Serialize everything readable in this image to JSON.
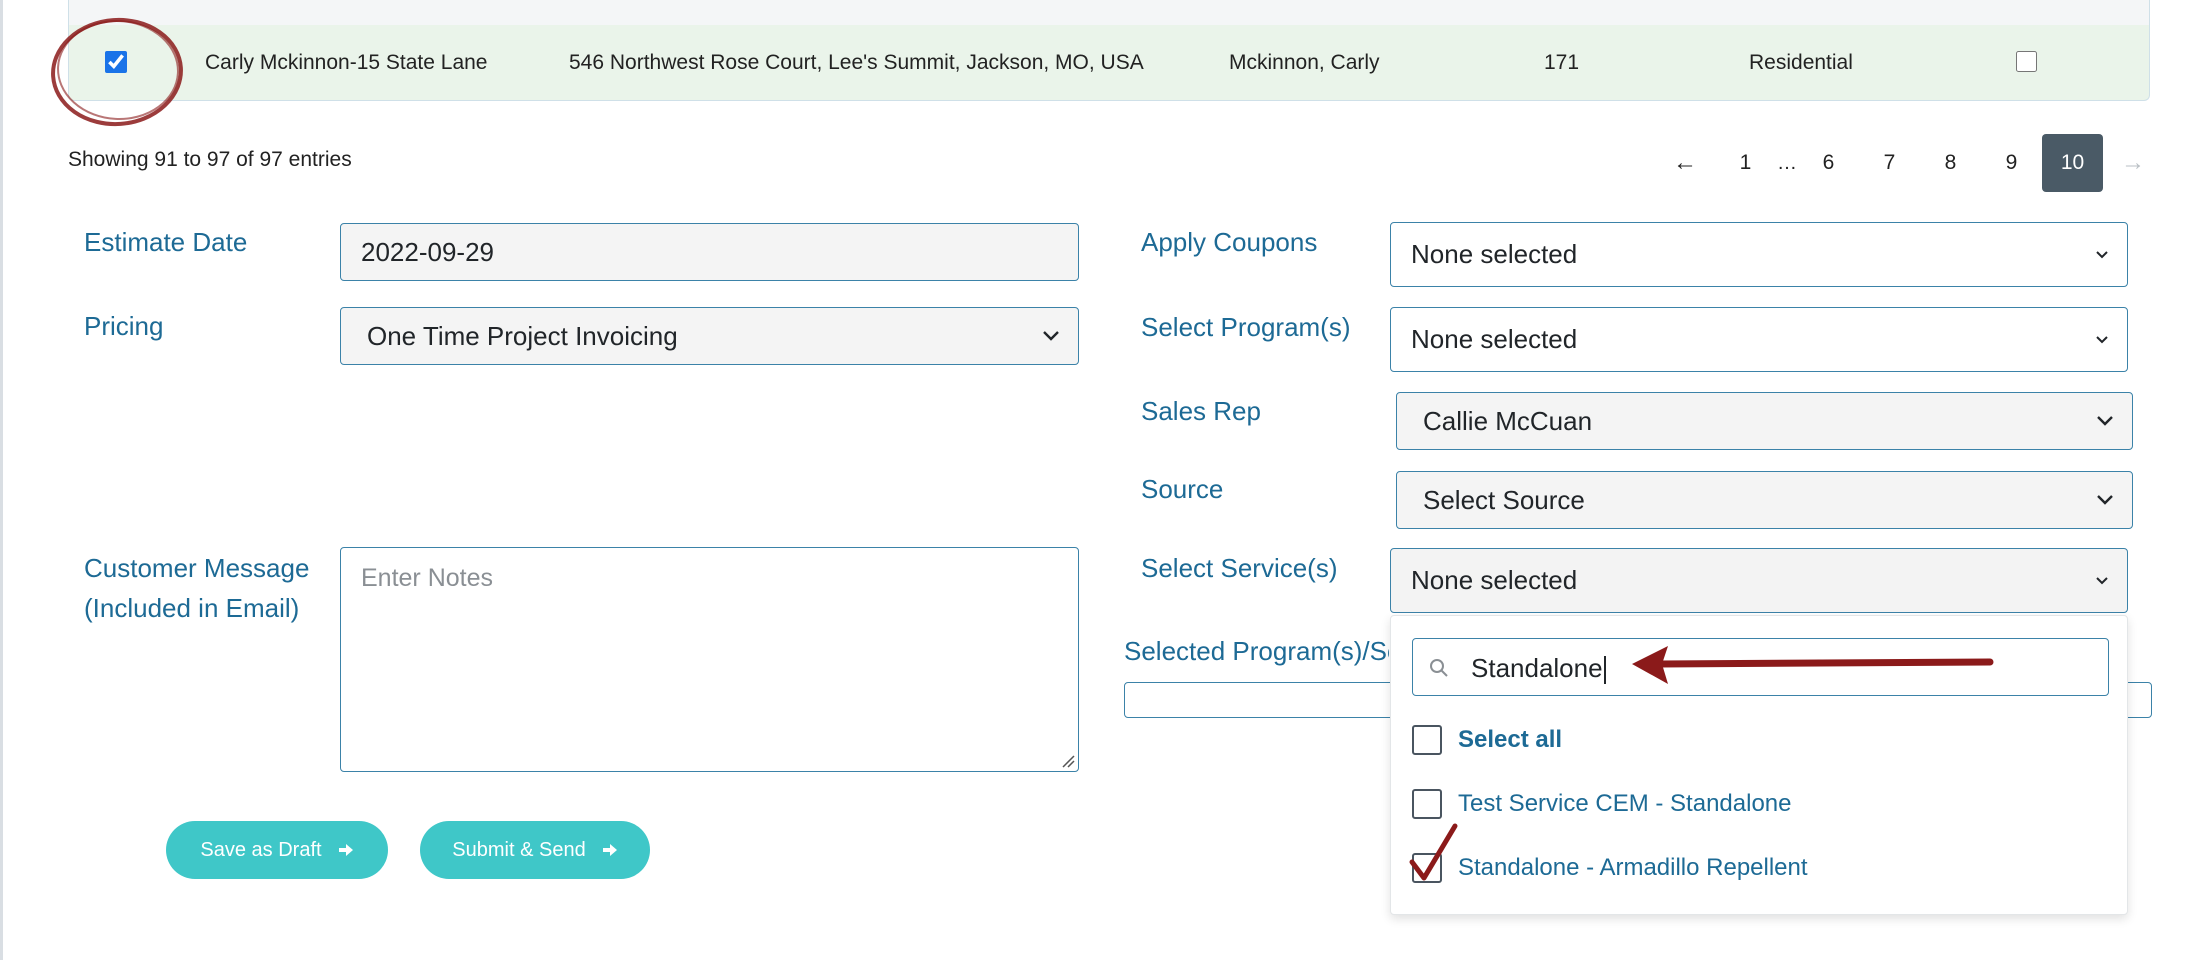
{
  "table": {
    "row": {
      "checked": true,
      "name": "Carly Mckinnon-15 State Lane",
      "address": "546 Northwest Rose Court, Lee's Summit, Jackson, MO, USA",
      "customer": "Mckinnon, Carly",
      "number": "171",
      "type": "Residential",
      "end_checkbox_checked": false
    },
    "entries_info": "Showing 91 to 97 of 97 entries",
    "pagination": {
      "prev": "←",
      "pages": [
        "1",
        "…",
        "6",
        "7",
        "8",
        "9",
        "10"
      ],
      "active": "10",
      "next": "→"
    }
  },
  "form": {
    "estimate_date": {
      "label": "Estimate Date",
      "value": "2022-09-29"
    },
    "pricing": {
      "label": "Pricing",
      "value": "One Time Project Invoicing"
    },
    "customer_message": {
      "label_line1": "Customer Message",
      "label_line2": "(Included in Email)",
      "placeholder": "Enter Notes"
    },
    "apply_coupons": {
      "label": "Apply Coupons",
      "value": "None selected"
    },
    "select_programs": {
      "label": "Select Program(s)",
      "value": "None selected"
    },
    "sales_rep": {
      "label": "Sales Rep",
      "value": "Callie McCuan"
    },
    "source": {
      "label": "Source",
      "value": "Select Source"
    },
    "select_services": {
      "label": "Select Service(s)",
      "value": "None selected"
    },
    "selected_programs_label": "Selected Program(s)/Se"
  },
  "buttons": {
    "save_draft": "Save as Draft",
    "submit_send": "Submit & Send"
  },
  "services_dropdown": {
    "search_value": "Standalone",
    "options": [
      {
        "label": "Select all",
        "bold": true,
        "checked": false
      },
      {
        "label": "Test Service CEM - Standalone",
        "bold": false,
        "checked": false
      },
      {
        "label": "Standalone - Armadillo Repellent",
        "bold": false,
        "checked": false
      }
    ]
  },
  "icons": {
    "search": "search-icon",
    "chevron": "chevron-down-icon",
    "arrow_right": "arrow-right-icon"
  },
  "colors": {
    "label_blue": "#1d6a95",
    "button_teal": "#3fc7c8",
    "row_highlight": "#eaf4ea",
    "pagination_active": "#4a5a66",
    "annotation_red": "#8b1a1a"
  }
}
